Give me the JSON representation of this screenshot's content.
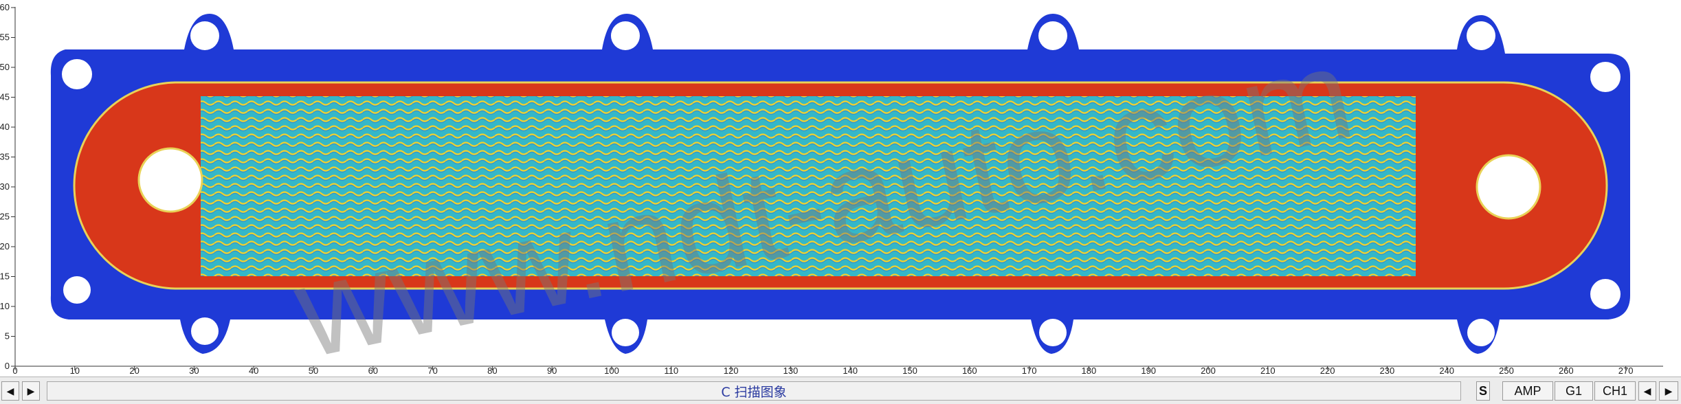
{
  "scan": {
    "y_axis_ticks": [
      "0",
      "5",
      "10",
      "15",
      "20",
      "25",
      "30",
      "35",
      "40",
      "45",
      "50",
      "55",
      "60"
    ],
    "x_axis_ticks": [
      "0",
      "10",
      "20",
      "30",
      "40",
      "50",
      "60",
      "70",
      "80",
      "90",
      "100",
      "110",
      "120",
      "130",
      "140",
      "150",
      "160",
      "170",
      "180",
      "190",
      "200",
      "210",
      "220",
      "230",
      "240",
      "250",
      "260",
      "270"
    ],
    "watermark": "www.ndt-auto.com",
    "colors": {
      "background_scale": "#1f3ad6",
      "high_amplitude": "#d8371a",
      "channel_band": "#2fb6c8",
      "wave_line": "#f2d12c"
    }
  },
  "statusbar": {
    "title": "C 扫描图象",
    "left_prev_icon": "triangle-left-icon",
    "left_next_icon": "triangle-right-icon",
    "mode_s": "S",
    "amp": "AMP",
    "gate": "G1",
    "channel": "CH1",
    "right_prev_icon": "triangle-left-icon",
    "right_next_icon": "triangle-right-icon"
  }
}
